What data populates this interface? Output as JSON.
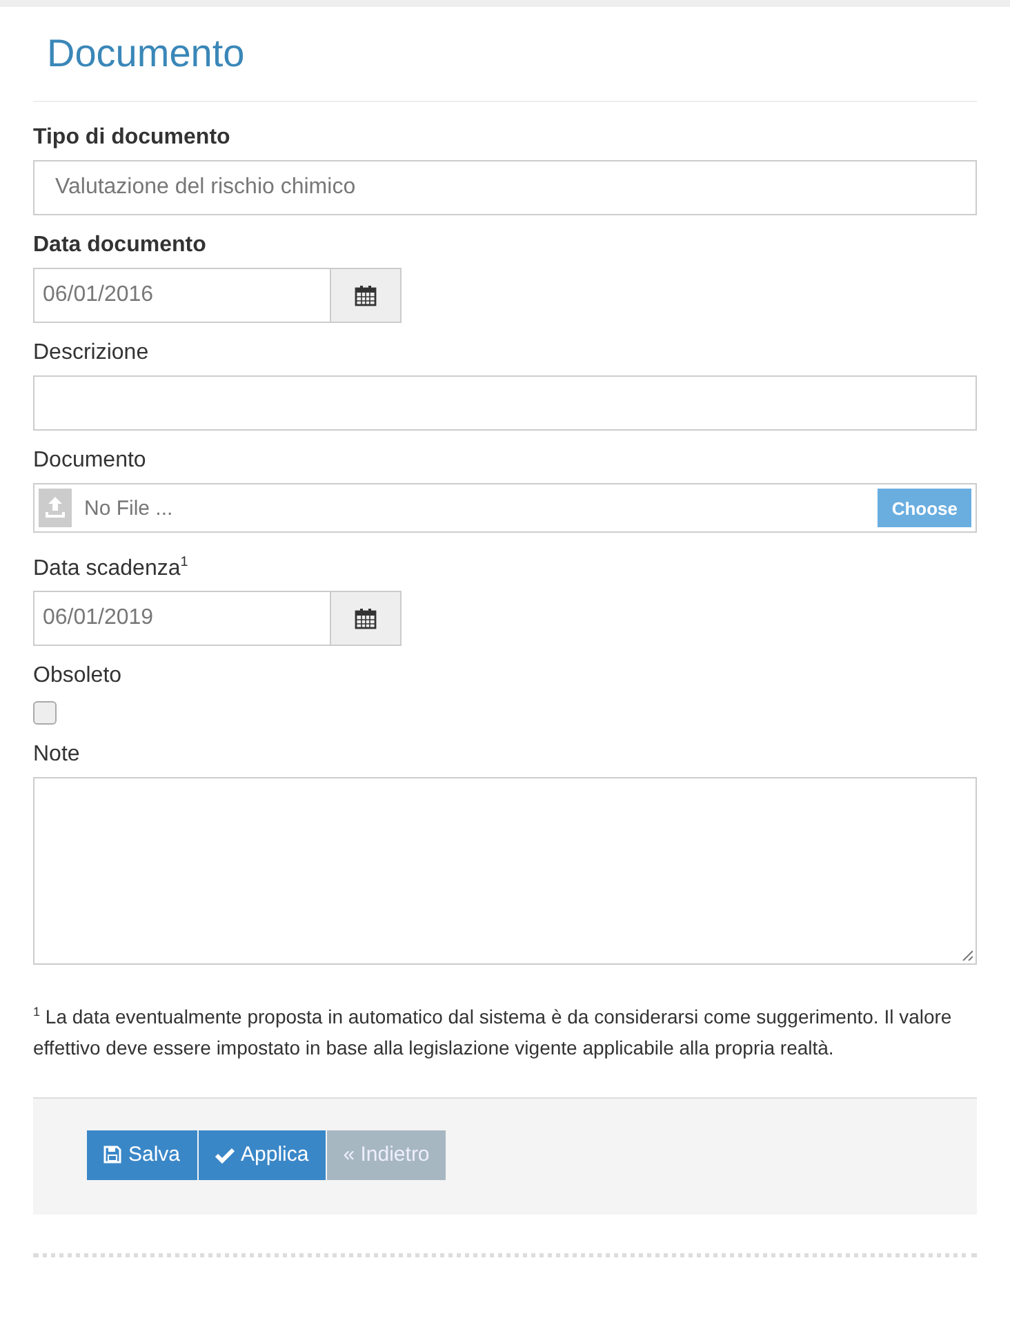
{
  "title": "Documento",
  "fields": [
    {
      "kind": "text",
      "label": "Tipo di documento",
      "bold": true,
      "value": "Valutazione del rischio chimico"
    },
    {
      "kind": "date",
      "label": "Data documento",
      "bold": true,
      "value": "06/01/2016"
    },
    {
      "kind": "text",
      "label": "Descrizione",
      "bold": false
    },
    {
      "kind": "file",
      "label": "Documento",
      "bold": false,
      "placeholder": "No File ...",
      "button": "Choose"
    },
    {
      "kind": "date",
      "label": "Data scadenza$^{1}$",
      "bold": false,
      "value": "06/01/2019"
    },
    {
      "kind": "checkbox",
      "label": "Obsoleto",
      "bold": false,
      "checked": false
    },
    {
      "kind": "textarea",
      "label": "Note",
      "bold": false
    }
  ],
  "footnote": "$^{1}$ La data eventualmente proposta in automatico dal sistema è da considerarsi come suggerimento. Il valore effettivo deve essere impostato in base alla legislazione vigente applicabile alla propria realtà.",
  "buttons": [
    {
      "label": "Salva",
      "disabled": false
    },
    {
      "label": "Applica",
      "disabled": false
    },
    {
      "label": "« Indietro",
      "disabled": true
    }
  ]
}
